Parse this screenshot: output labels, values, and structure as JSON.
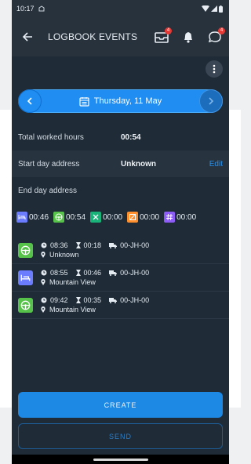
{
  "status": {
    "time": "10:17"
  },
  "header": {
    "title": "LOGBOOK EVENTS",
    "messages_badge": "4",
    "notif_badge": "4",
    "chat_badge": "4"
  },
  "date": {
    "label": "Thursday, 11 May"
  },
  "info": {
    "total_label": "Total worked hours",
    "total_value": "00:54",
    "start_label": "Start day address",
    "start_value": "Unknown",
    "edit_label": "Edit",
    "end_label": "End day address"
  },
  "summary": [
    {
      "value": "00:46",
      "color": "#6b7cff",
      "icon": "bed-icon"
    },
    {
      "value": "00:54",
      "color": "#57c24a",
      "icon": "steering-wheel-icon"
    },
    {
      "value": "00:00",
      "color": "#19b37a",
      "icon": "tools-icon"
    },
    {
      "value": "00:00",
      "color": "#ff8f2d",
      "icon": "availability-icon"
    },
    {
      "value": "00:00",
      "color": "#8d5cf6",
      "icon": "hash-icon"
    }
  ],
  "events": [
    {
      "type": "drive",
      "color": "#57c24a",
      "time": "08:36",
      "duration": "00:18",
      "plate": "00-JH-00",
      "location": "Unknown"
    },
    {
      "type": "rest",
      "color": "#6b7cff",
      "time": "08:55",
      "duration": "00:46",
      "plate": "00-JH-00",
      "location": "Mountain View"
    },
    {
      "type": "drive",
      "color": "#57c24a",
      "time": "09:42",
      "duration": "00:35",
      "plate": "00-JH-00",
      "location": "Mountain View"
    }
  ],
  "actions": {
    "create_label": "CREATE",
    "send_label": "SEND"
  }
}
